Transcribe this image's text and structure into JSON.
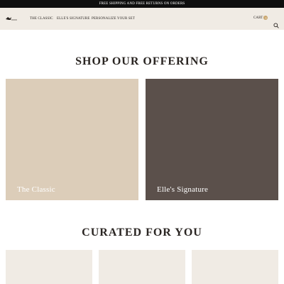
{
  "announcement": "FREE SHIPPING AND FREE RETURNS ON ORDERS",
  "header": {
    "nav": [
      "THE CLASSIC",
      "ELLE'S SIGNATURE",
      "PERSONALIZE YOUR SET"
    ],
    "cart_label": "CART",
    "cart_count": "0",
    "icons": [
      "logo-icon",
      "search-icon"
    ]
  },
  "offering": {
    "title": "SHOP OUR OFFERING",
    "tiles": [
      {
        "label": "The Classic",
        "color": "#dccdb9"
      },
      {
        "label": "Elle's Signature",
        "color": "#5b504b"
      }
    ]
  },
  "curated": {
    "title": "CURATED FOR YOU"
  },
  "colors": {
    "header_bg": "#f0ebe4",
    "announcement_bg": "#0f0f0f",
    "cart_badge": "#c8a46a"
  }
}
